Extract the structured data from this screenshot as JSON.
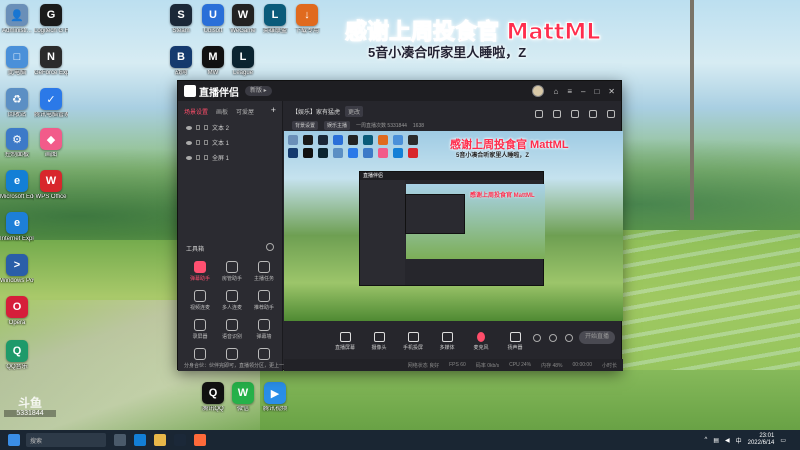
{
  "overlay": {
    "headline": "感谢上周投食官 MattML",
    "subline": "5音小凑合听家里人睡啦，Z"
  },
  "desktop_icons": [
    {
      "label": "Administr...",
      "color": "#6a8fb8",
      "glyph": "👤"
    },
    {
      "label": "Logitech G HUB",
      "color": "#1a1a1a",
      "glyph": "G"
    },
    {
      "label": "Steam",
      "color": "#1b2838",
      "glyph": "S"
    },
    {
      "label": "Ubisoft",
      "color": "#2a6fd8",
      "glyph": "U"
    },
    {
      "label": "WeGame",
      "color": "#222",
      "glyph": "W"
    },
    {
      "label": "英雄联盟",
      "color": "#0a5b7a",
      "glyph": "L"
    },
    {
      "label": "下载专用",
      "color": "#e06a1e",
      "glyph": "↓"
    },
    {
      "label": "此电脑",
      "color": "#4a90d9",
      "glyph": "□"
    },
    {
      "label": "GeForce Experience",
      "color": "#2b2b2b",
      "glyph": "N"
    },
    {
      "label": "战网",
      "color": "#153a6e",
      "glyph": "B"
    },
    {
      "label": "MW",
      "color": "#111",
      "glyph": "M"
    },
    {
      "label": "League",
      "color": "#0b2430",
      "glyph": "L"
    },
    {
      "label": "回收站",
      "color": "#5b8fc4",
      "glyph": "♻"
    },
    {
      "label": "腾讯电脑管家",
      "color": "#2b79e8",
      "glyph": "✓"
    },
    {
      "label": "控制面板",
      "color": "#3d7ac8",
      "glyph": "⚙"
    },
    {
      "label": "画图",
      "color": "#f25b8a",
      "glyph": "◆"
    },
    {
      "label": "Microsoft Edge",
      "color": "#137fd6",
      "glyph": "e"
    },
    {
      "label": "WPS Office",
      "color": "#d8262c",
      "glyph": "W"
    },
    {
      "label": "Internet Explorer",
      "color": "#1d7fd8",
      "glyph": "e"
    },
    {
      "label": "Windows PowerShell",
      "color": "#2a5ea8",
      "glyph": ">"
    },
    {
      "label": "Opera",
      "color": "#d61e3a",
      "glyph": "O"
    },
    {
      "label": "QQ音乐",
      "color": "#1e9a6a",
      "glyph": "Q"
    },
    {
      "label": "腾讯QQ",
      "color": "#111",
      "glyph": "Q"
    },
    {
      "label": "微信",
      "color": "#26b14a",
      "glyph": "W"
    },
    {
      "label": "腾讯视频",
      "color": "#2a8ee8",
      "glyph": "▶"
    }
  ],
  "app": {
    "title": "直播伴侣",
    "badge": "新版 ▸",
    "left_tabs": [
      "场景设置",
      "画板",
      "可爱屋"
    ],
    "sources": [
      "文本 2",
      "文本 1",
      "全屏 1"
    ],
    "tools_title": "工具箱",
    "tools": [
      {
        "label": "弹幕助手",
        "red": true
      },
      {
        "label": "房管助手",
        "red": false
      },
      {
        "label": "主播任务",
        "red": false
      },
      {
        "label": "视频连麦",
        "red": false
      },
      {
        "label": "多人连麦",
        "red": false
      },
      {
        "label": "推荐助手",
        "red": false
      },
      {
        "label": "录屏器",
        "red": false
      },
      {
        "label": "语音识别",
        "red": false
      },
      {
        "label": "弹幕墙",
        "red": false
      },
      {
        "label": "",
        "red": false
      },
      {
        "label": "",
        "red": false
      },
      {
        "label": "",
        "red": false
      }
    ],
    "notice": "分身合伙：伙伴完即可，直播领分区，更上一层楼",
    "room_title": "【娱乐】家有猛虎",
    "room_tag": "更改",
    "room_chip1": "背景设置",
    "room_chip2": "娱乐主播",
    "room_meta": "一周直播次数 5331844",
    "room_count": "1638",
    "preview_head": "感谢上周投食官 MattML",
    "preview_sub": "5音小凑合听家里人睡啦，Z",
    "nested_head": "感谢上周投食官 MattML",
    "controls": [
      "直播屏幕",
      "摄像头",
      "手机投屏",
      "多媒体",
      "麦克风",
      "扬声器"
    ],
    "go_live": "开始直播",
    "status": [
      "网络状态 良好",
      "FPS 60",
      "码率 0kb/s",
      "CPU 24%",
      "内存 48%",
      "00:00:00",
      "小时长"
    ]
  },
  "watermark": {
    "logo": "斗鱼",
    "id": "5331844"
  },
  "taskbar": {
    "search": "搜索",
    "time": "23:01",
    "date": "2022/6/14"
  },
  "colors": {
    "accent": "#ff4d6a",
    "window_bg": "#26262c",
    "taskbar": "#1a2633"
  }
}
